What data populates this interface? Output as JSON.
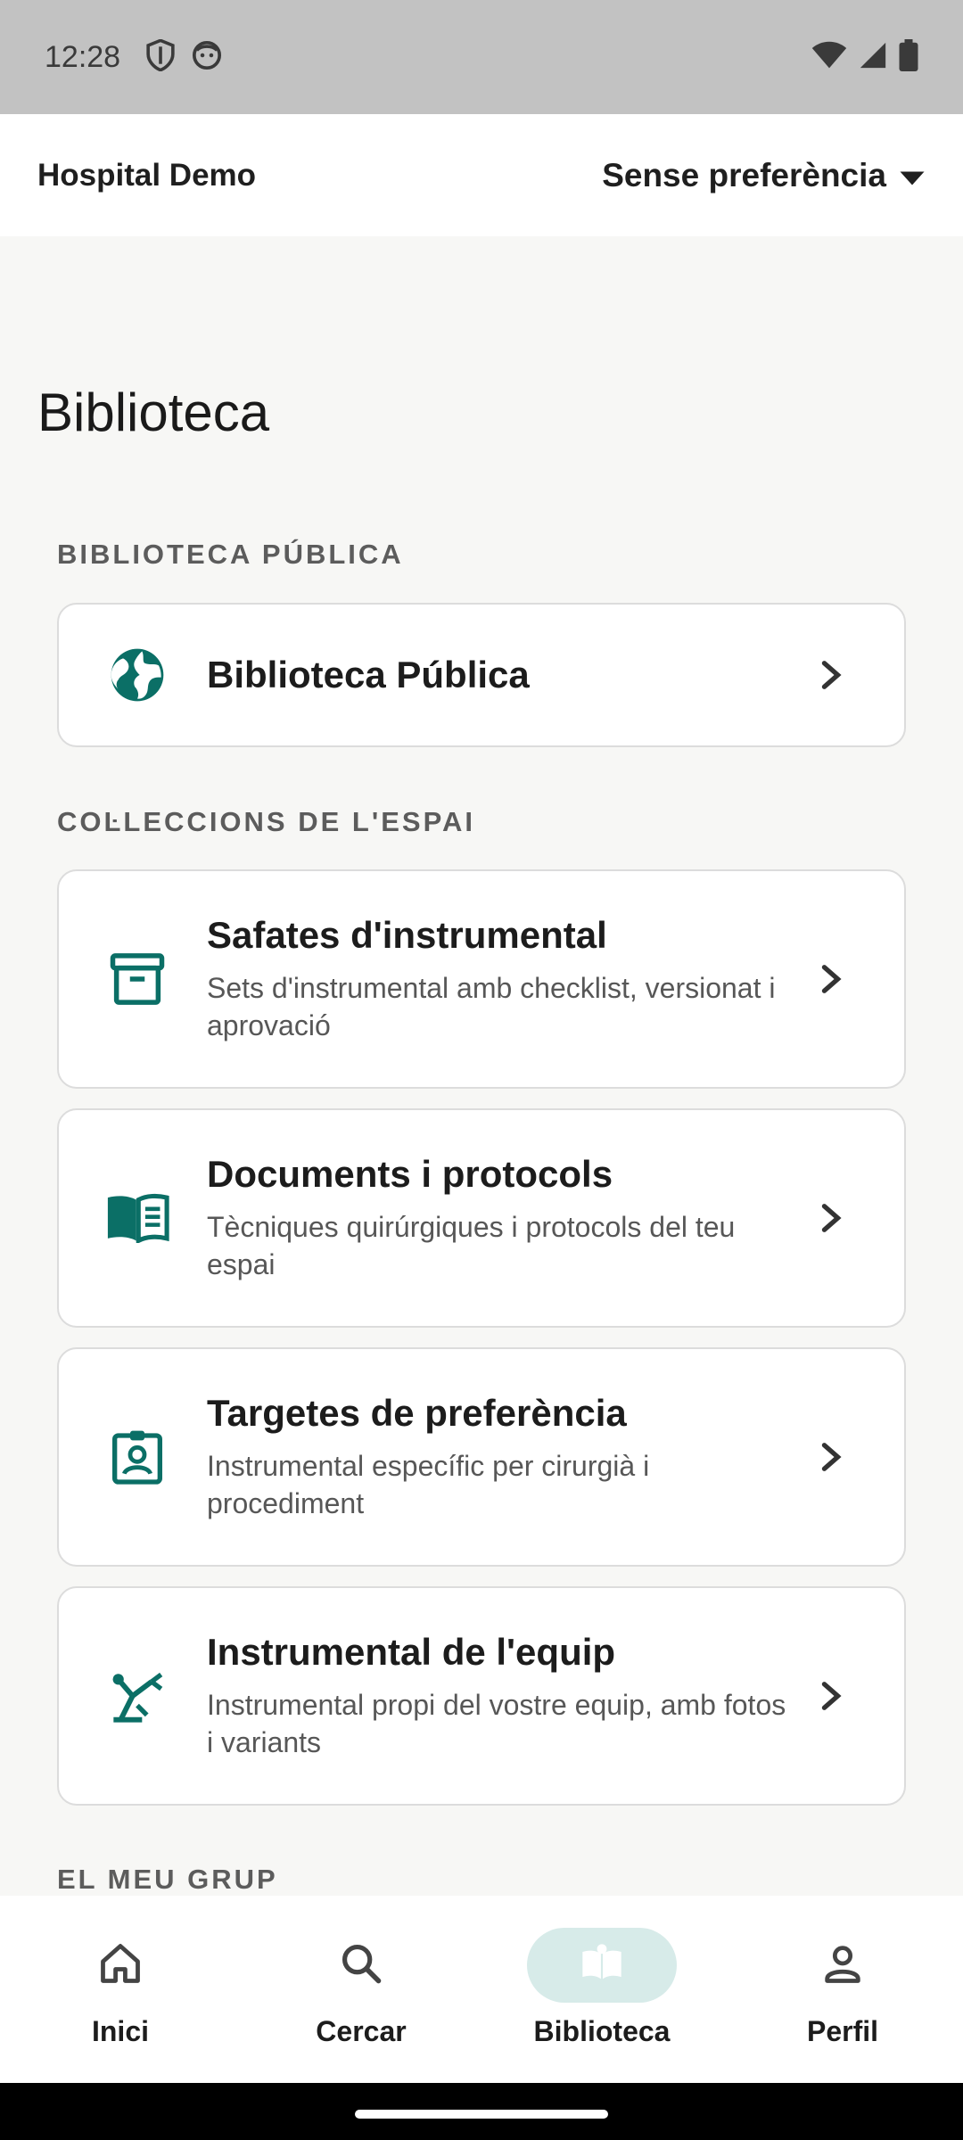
{
  "status_bar": {
    "time": "12:28",
    "icons": [
      "shield-icon",
      "face-icon",
      "wifi-icon",
      "signal-icon",
      "battery-icon"
    ]
  },
  "header": {
    "org_name": "Hospital Demo",
    "preference_selected": "Sense preferència"
  },
  "page": {
    "title": "Biblioteca"
  },
  "sections": {
    "public": {
      "label": "BIBLIOTECA PÚBLICA",
      "card_title": "Biblioteca Pública"
    },
    "space": {
      "label": "COĿLECCIONS DE L'ESPAI",
      "cards": [
        {
          "title": "Safates d'instrumental",
          "subtitle": "Sets d'instrumental amb checklist, versionat i aprovació",
          "icon": "archive-icon"
        },
        {
          "title": "Documents i protocols",
          "subtitle": "Tècniques quirúrgiques i protocols del teu espai",
          "icon": "book-icon"
        },
        {
          "title": "Targetes de preferència",
          "subtitle": "Instrumental específic per cirurgià i procediment",
          "icon": "badge-icon"
        },
        {
          "title": "Instrumental de l'equip",
          "subtitle": "Instrumental propi del vostre equip, amb fotos i variants",
          "icon": "tool-icon"
        }
      ]
    },
    "group": {
      "label": "EL MEU GRUP"
    }
  },
  "bottom_nav": {
    "items": [
      {
        "label": "Inici",
        "icon": "home-icon"
      },
      {
        "label": "Cercar",
        "icon": "search-icon"
      },
      {
        "label": "Biblioteca",
        "icon": "library-icon",
        "active": true
      },
      {
        "label": "Perfil",
        "icon": "person-icon"
      }
    ]
  },
  "colors": {
    "accent": "#0b6f66",
    "active_pill": "#d7ebe9",
    "background": "#f7f7f5"
  }
}
